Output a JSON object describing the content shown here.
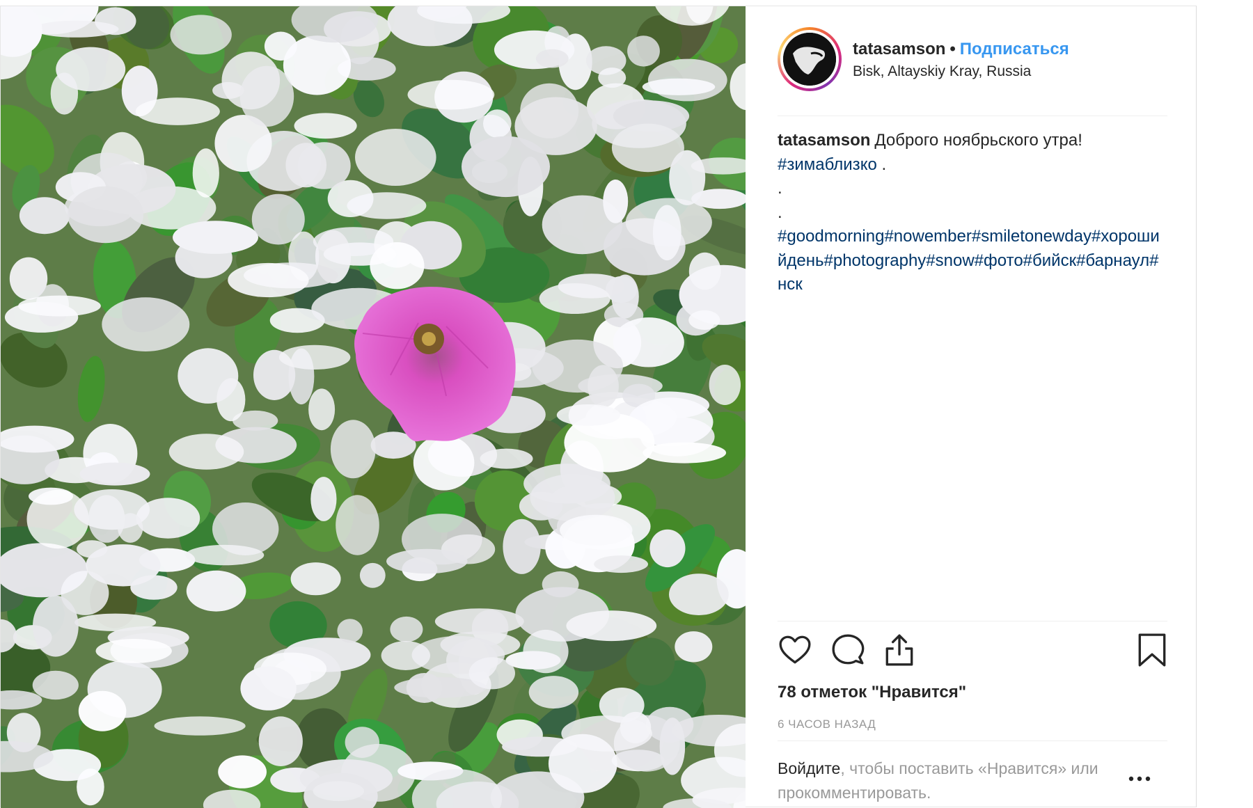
{
  "post": {
    "username": "tatasamson",
    "separator": "•",
    "follow_label": "Подписаться",
    "location": "Bisk, Altayskiy Kray, Russia"
  },
  "caption": {
    "username": "tatasamson",
    "line1": "Доброго ноябрьского утра!",
    "hashtag1": "#зимаблизко",
    "hashtag1_suffix": " .",
    "dot1": ".",
    "dot2": ".",
    "hashtags": "#goodmorning#nowember#smiletonewday#хорошийдень#photography#snow#фото#бийск#барнаул#нск"
  },
  "actions": {
    "like_icon": "heart-icon",
    "comment_icon": "comment-icon",
    "share_icon": "share-icon",
    "save_icon": "bookmark-icon"
  },
  "likes_text": "78 отметок \"Нравится\"",
  "time_text": "6 ЧАСОВ НАЗАД",
  "login": {
    "link": "Войдите",
    "rest": ", чтобы поставить «Нравится» или прокомментировать.",
    "more_icon": "more-options-icon"
  },
  "colors": {
    "link_blue": "#3897f0",
    "hashtag": "#003569",
    "muted": "#999999",
    "text": "#262626"
  }
}
